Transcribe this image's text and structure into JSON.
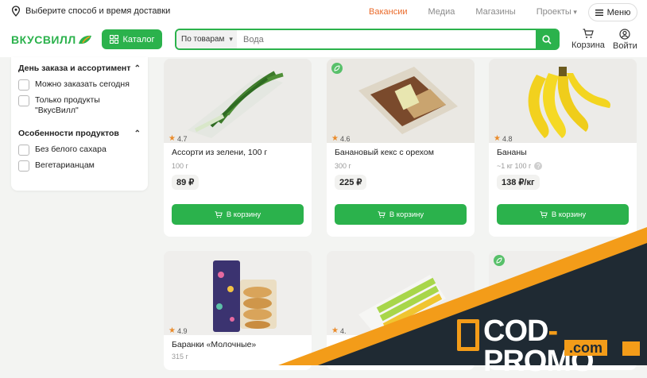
{
  "topbar": {
    "delivery_text": "Выберите способ и время доставки",
    "nav": [
      {
        "label": "Вакансии",
        "active": true
      },
      {
        "label": "Медиа",
        "active": false
      },
      {
        "label": "Магазины",
        "active": false
      },
      {
        "label": "Проекты",
        "active": false
      }
    ],
    "menu_label": "Меню"
  },
  "header": {
    "logo": "ВКУСВИЛЛ",
    "catalog_label": "Каталог",
    "search_scope": "По товарам",
    "search_placeholder": "Вода",
    "cart_label": "Корзина",
    "login_label": "Войти"
  },
  "filters": {
    "groups": [
      {
        "title": "День заказа и ассортимент",
        "items": [
          "Можно заказать сегодня",
          "Только продукты \"ВкусВилл\""
        ]
      },
      {
        "title": "Особенности продуктов",
        "items": [
          "Без белого сахара",
          "Вегетарианцам"
        ]
      }
    ]
  },
  "products": [
    {
      "name": "Ассорти из зелени, 100 г",
      "weight": "100 г",
      "price": "89 ₽",
      "rating": "4.7",
      "eco": false,
      "cart_label": "В корзину"
    },
    {
      "name": "Банановый кекс с орехом",
      "weight": "300 г",
      "price": "225 ₽",
      "rating": "4.6",
      "eco": true,
      "cart_label": "В корзину"
    },
    {
      "name": "Бананы",
      "weight": "~1 кг 100 г",
      "price": "138 ₽/кг",
      "rating": "4.8",
      "eco": false,
      "cart_label": "В корзину"
    },
    {
      "name": "Баранки «Молочные»",
      "weight": "315 г",
      "rating": "4.9",
      "eco": false
    },
    {
      "rating": "4.",
      "eco": false
    },
    {
      "eco": true
    }
  ],
  "promo": {
    "main": "COD",
    "dash": "-",
    "second": "PROMO",
    "domain": ".com"
  },
  "colors": {
    "brand_green": "#2bb24c",
    "active_nav": "#ea6b2b",
    "promo_orange": "#f39c19",
    "promo_dark": "#1f2a33"
  }
}
